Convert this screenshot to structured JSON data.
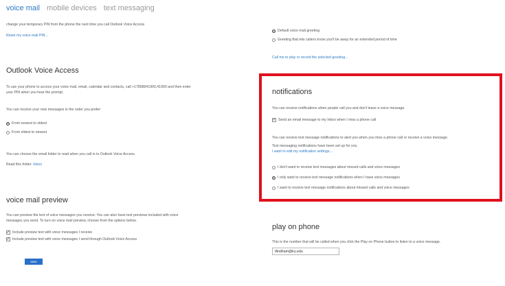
{
  "tabs": [
    "voice mail",
    "mobile devices",
    "text messaging"
  ],
  "left": {
    "pin_text": "change your temporary PIN from the phone the next time you call Outlook Voice Access",
    "reset_pin_link": "Reset my voice mail PIN...",
    "ova": {
      "title": "Outlook Voice Access",
      "desc_line1": "To use your phone to access your voice mail, email, calendar and contacts, call +17858641900,41900 and then enter",
      "desc_line2": "your PIN when you hear the prompt.",
      "order_label": "You can receive your new messages in the order you prefer:",
      "order_options": [
        "From newest to oldest",
        "From oldest to newest"
      ],
      "folder_text": "You can choose the email folder to read when you call in to Outlook Voice Access.",
      "read_folder_label": "Read this folder:",
      "read_folder_link": "Inbox"
    },
    "preview": {
      "title": "voice mail preview",
      "desc_line1": "You can preview the text of voice messages you receive. You can also have text previews included with voice",
      "desc_line2": "messages you send. To turn on voice mail preview, choose from the options below.",
      "checks": [
        "Include preview text with voice messages I receive",
        "Include preview text with voice messages I send through Outlook Voice Access"
      ]
    },
    "save_label": "save"
  },
  "greeting": {
    "options": [
      "Default voice mail greeting",
      "Greeting that lets callers know you'll be away for an extended period of time"
    ],
    "call_link": "Call me to play or record the selected greeting..."
  },
  "notifications": {
    "title": "notifications",
    "desc": "You can receive notifications when people call you and don't leave a voice message.",
    "email_check": "Send an email message to my Inbox when I miss a phone call",
    "text_desc": "You can receive text message notifications to alert you when you miss a phone call or receive a voice message.",
    "setup_text": "Text messaging notifications have been set up for you.",
    "edit_link": "I want to edit my notification settings...",
    "options": [
      "I don't want to receive text messages about missed calls and voice messages",
      "I only want to receive text message notifications when I have voice messages",
      "I want to receive text message notifications about missed calls and voice messages"
    ]
  },
  "play_on_phone": {
    "title": "play on phone",
    "desc": "This is the number that will be called when you click the Play on Phone button to listen to a voice message.",
    "number_value": "tfindham@ku.edu"
  }
}
